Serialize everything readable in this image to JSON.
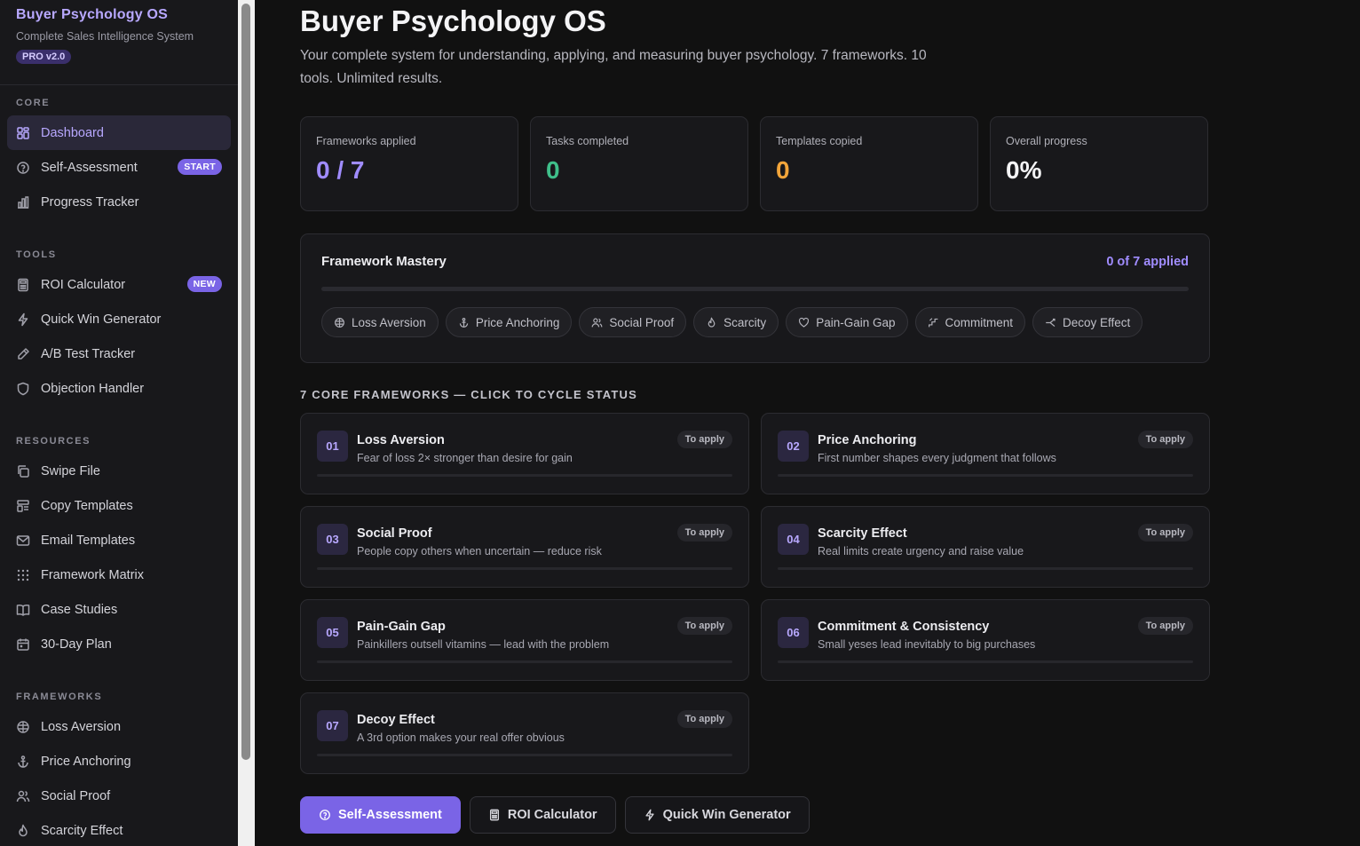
{
  "brand": {
    "title": "Buyer Psychology OS",
    "subtitle": "Complete Sales Intelligence System",
    "badge": "PRO v2.0"
  },
  "sidebar": {
    "sections": [
      {
        "label": "CORE",
        "items": [
          {
            "label": "Dashboard",
            "icon": "grid-icon",
            "active": true
          },
          {
            "label": "Self-Assessment",
            "icon": "help-circle-icon",
            "pill": "START"
          },
          {
            "label": "Progress Tracker",
            "icon": "bar-chart-icon"
          }
        ]
      },
      {
        "label": "TOOLS",
        "items": [
          {
            "label": "ROI Calculator",
            "icon": "calculator-icon",
            "pill": "NEW"
          },
          {
            "label": "Quick Win Generator",
            "icon": "lightning-icon"
          },
          {
            "label": "A/B Test Tracker",
            "icon": "flask-icon"
          },
          {
            "label": "Objection Handler",
            "icon": "shield-icon"
          }
        ]
      },
      {
        "label": "RESOURCES",
        "items": [
          {
            "label": "Swipe File",
            "icon": "copy-icon"
          },
          {
            "label": "Copy Templates",
            "icon": "layout-icon"
          },
          {
            "label": "Email Templates",
            "icon": "mail-icon"
          },
          {
            "label": "Framework Matrix",
            "icon": "dots-grid-icon"
          },
          {
            "label": "Case Studies",
            "icon": "book-icon"
          },
          {
            "label": "30-Day Plan",
            "icon": "calendar-icon"
          }
        ]
      },
      {
        "label": "FRAMEWORKS",
        "items": [
          {
            "label": "Loss Aversion",
            "icon": "brain-icon"
          },
          {
            "label": "Price Anchoring",
            "icon": "anchor-icon"
          },
          {
            "label": "Social Proof",
            "icon": "users-icon"
          },
          {
            "label": "Scarcity Effect",
            "icon": "flame-icon"
          }
        ]
      }
    ]
  },
  "main": {
    "title": "Buyer Psychology OS",
    "description": "Your complete system for understanding, applying, and measuring buyer psychology. 7 frameworks. 10 tools. Unlimited results.",
    "stats": [
      {
        "label": "Frameworks applied",
        "value": "0 / 7",
        "color": "#a08cff"
      },
      {
        "label": "Tasks completed",
        "value": "0",
        "color": "#3fbf8a"
      },
      {
        "label": "Templates copied",
        "value": "0",
        "color": "#f2a53a"
      },
      {
        "label": "Overall progress",
        "value": "0%",
        "color": "#f4f4f6"
      }
    ],
    "mastery": {
      "title": "Framework Mastery",
      "count_label": "0 of 7 applied",
      "progress_fraction": 0,
      "chips": [
        {
          "label": "Loss Aversion",
          "icon": "brain-icon"
        },
        {
          "label": "Price Anchoring",
          "icon": "anchor-icon"
        },
        {
          "label": "Social Proof",
          "icon": "users-icon"
        },
        {
          "label": "Scarcity",
          "icon": "flame-icon"
        },
        {
          "label": "Pain-Gain Gap",
          "icon": "heart-icon"
        },
        {
          "label": "Commitment",
          "icon": "stairs-icon"
        },
        {
          "label": "Decoy Effect",
          "icon": "split-icon"
        }
      ]
    },
    "frameworks_heading": "7 CORE FRAMEWORKS — CLICK TO CYCLE STATUS",
    "frameworks": [
      {
        "num": "01",
        "name": "Loss Aversion",
        "desc": "Fear of loss 2× stronger than desire for gain",
        "status": "To apply"
      },
      {
        "num": "02",
        "name": "Price Anchoring",
        "desc": "First number shapes every judgment that follows",
        "status": "To apply"
      },
      {
        "num": "03",
        "name": "Social Proof",
        "desc": "People copy others when uncertain — reduce risk",
        "status": "To apply"
      },
      {
        "num": "04",
        "name": "Scarcity Effect",
        "desc": "Real limits create urgency and raise value",
        "status": "To apply"
      },
      {
        "num": "05",
        "name": "Pain-Gain Gap",
        "desc": "Painkillers outsell vitamins — lead with the problem",
        "status": "To apply"
      },
      {
        "num": "06",
        "name": "Commitment & Consistency",
        "desc": "Small yeses lead inevitably to big purchases",
        "status": "To apply"
      },
      {
        "num": "07",
        "name": "Decoy Effect",
        "desc": "A 3rd option makes your real offer obvious",
        "status": "To apply"
      }
    ],
    "actions": [
      {
        "label": "Self-Assessment",
        "icon": "help-circle-icon",
        "primary": true
      },
      {
        "label": "ROI Calculator",
        "icon": "calculator-icon"
      },
      {
        "label": "Quick Win Generator",
        "icon": "lightning-icon"
      }
    ]
  }
}
